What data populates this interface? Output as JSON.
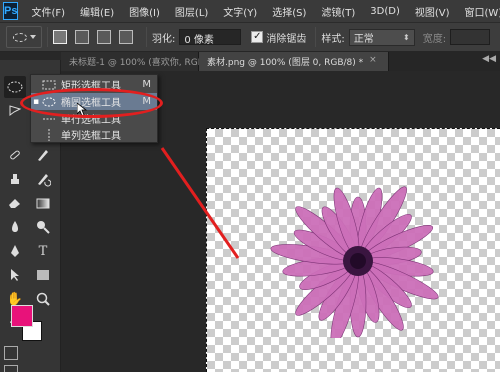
{
  "app": {
    "logo": "Ps",
    "menu": [
      "文件(F)",
      "编辑(E)",
      "图像(I)",
      "图层(L)",
      "文字(Y)",
      "选择(S)",
      "滤镜(T)",
      "3D(D)",
      "视图(V)",
      "窗口(W)"
    ]
  },
  "options": {
    "feather_label": "羽化:",
    "feather_value": "0 像素",
    "antialias_label": "消除锯齿",
    "antialias_checked": "✓",
    "style_label": "样式:",
    "style_value": "正常",
    "width_label": "宽度:"
  },
  "tabs": [
    {
      "label": "未标题-1 @ 100% (喜欢你, RGB/8) *",
      "close": "×"
    },
    {
      "label": "素材.png @ 100% (图层 0, RGB/8) *",
      "close": "×"
    }
  ],
  "collapse_glyph": "◀◀",
  "flyout": {
    "items": [
      {
        "label": "矩形选框工具",
        "shortcut": "M",
        "bullet": ""
      },
      {
        "label": "椭圆选框工具",
        "shortcut": "M",
        "bullet": "▪"
      },
      {
        "label": "单行选框工具",
        "shortcut": "",
        "bullet": ""
      },
      {
        "label": "单列选框工具",
        "shortcut": "",
        "bullet": ""
      }
    ]
  },
  "colors": {
    "foreground": "#e8127a",
    "background": "#ffffff",
    "annotation": "#e21f1f",
    "flower": "#cc6fb9"
  },
  "toolbar_icons": [
    "marquee-icon",
    "lasso-icon",
    "brush-icon",
    "eraser-icon",
    "pen-icon",
    "type-icon",
    "hand-icon",
    "zoom-icon"
  ]
}
